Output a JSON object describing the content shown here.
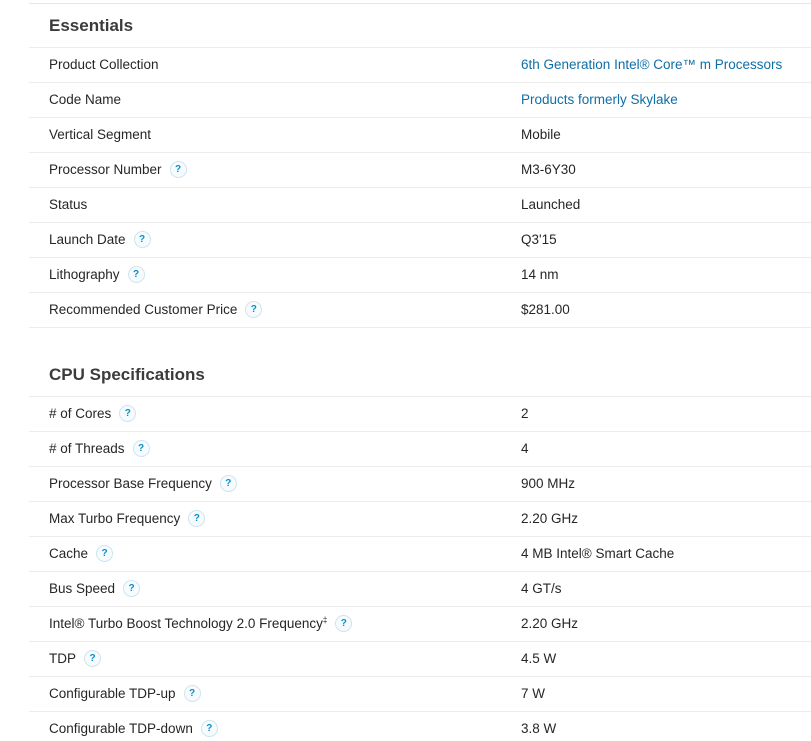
{
  "help_glyph": "?",
  "essentials": {
    "title": "Essentials",
    "rows": [
      {
        "label": "Product Collection",
        "value": "6th Generation Intel® Core™ m Processors"
      },
      {
        "label": "Code Name",
        "value": "Products formerly Skylake"
      },
      {
        "label": "Vertical Segment",
        "value": "Mobile"
      },
      {
        "label": "Processor Number",
        "value": "M3-6Y30"
      },
      {
        "label": "Status",
        "value": "Launched"
      },
      {
        "label": "Launch Date",
        "value": "Q3'15"
      },
      {
        "label": "Lithography",
        "value": "14 nm"
      },
      {
        "label": "Recommended Customer Price",
        "value": "$281.00"
      }
    ]
  },
  "cpu_specs": {
    "title": "CPU Specifications",
    "rows": [
      {
        "label": "# of Cores",
        "value": "2"
      },
      {
        "label": "# of Threads",
        "value": "4"
      },
      {
        "label": "Processor Base Frequency",
        "value": "900 MHz"
      },
      {
        "label": "Max Turbo Frequency",
        "value": "2.20 GHz"
      },
      {
        "label": "Cache",
        "value": "4 MB Intel® Smart Cache"
      },
      {
        "label": "Bus Speed",
        "value": "4 GT/s"
      },
      {
        "label": "Intel® Turbo Boost Technology 2.0 Frequency",
        "label_sup": "‡",
        "value": "2.20 GHz"
      },
      {
        "label": "TDP",
        "value": "4.5 W"
      },
      {
        "label": "Configurable TDP-up",
        "value": "7 W"
      },
      {
        "label": "Configurable TDP-down",
        "value": "3.8 W"
      }
    ]
  },
  "colors": {
    "link": "#0e6ea7",
    "help_icon": "#0b8ec8",
    "divider": "#ececec"
  }
}
